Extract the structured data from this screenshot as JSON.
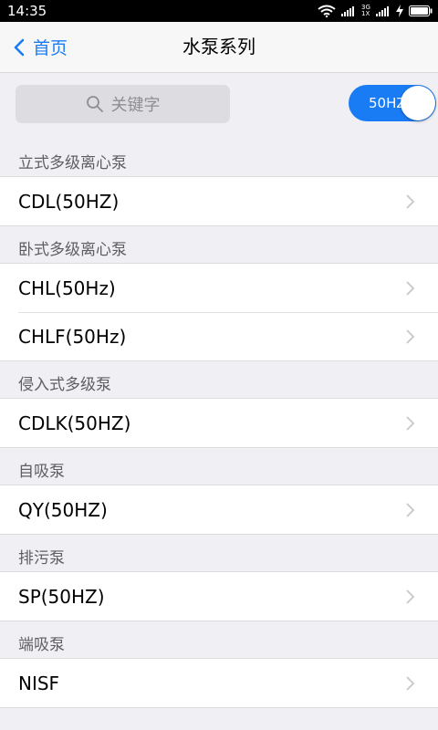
{
  "status_bar": {
    "time": "14:35",
    "signal_text": "3G 1X"
  },
  "nav": {
    "back_label": "首页",
    "title": "水泵系列"
  },
  "search": {
    "placeholder": "关键字"
  },
  "frequency_toggle": {
    "label": "50HZ",
    "on": true
  },
  "sections": [
    {
      "header": "立式多级离心泵",
      "items": [
        "CDL(50HZ)"
      ]
    },
    {
      "header": "卧式多级离心泵",
      "items": [
        "CHL(50Hz)",
        "CHLF(50Hz)"
      ]
    },
    {
      "header": "侵入式多级泵",
      "items": [
        "CDLK(50HZ)"
      ]
    },
    {
      "header": "自吸泵",
      "items": [
        "QY(50HZ)"
      ]
    },
    {
      "header": "排污泵",
      "items": [
        "SP(50HZ)"
      ]
    },
    {
      "header": "端吸泵",
      "items": [
        "NISF"
      ]
    }
  ],
  "colors": {
    "accent": "#1a7cf5",
    "background": "#efeff4",
    "chevron": "#c7c7cc"
  }
}
